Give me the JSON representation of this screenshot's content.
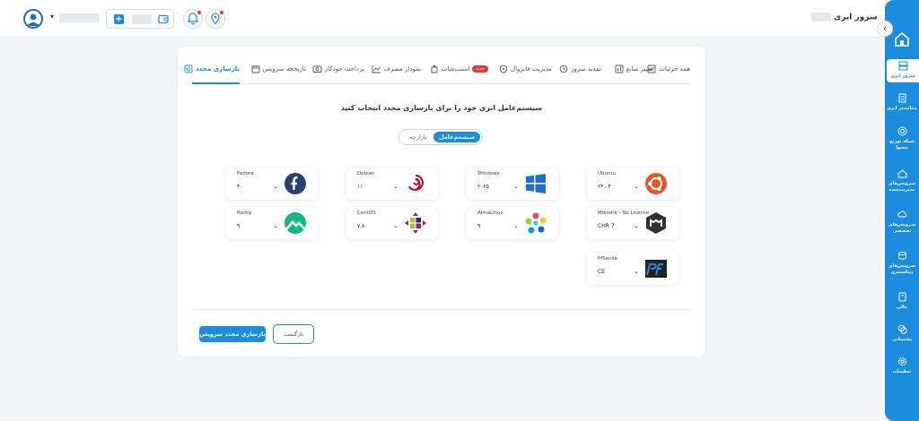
{
  "header": {
    "breadcrumb": "سرور ابری"
  },
  "sidebar": {
    "items": [
      {
        "label": "سرور ابری",
        "icon": "server-icon"
      },
      {
        "label": "دیتاسنتر ابری",
        "icon": "datacenter-icon"
      },
      {
        "label": "شبکه توزیع محتوا",
        "icon": "cdn-icon"
      },
      {
        "label": "سرویس‌های مدیریت‌شده",
        "icon": "cloud-managed-icon"
      },
      {
        "label": "سرویس‌های تخصصی",
        "icon": "cloud-special-icon"
      },
      {
        "label": "سرویس‌های دیتاسنتری",
        "icon": "datacenter-services-icon"
      },
      {
        "label": "مالی",
        "icon": "finance-icon"
      },
      {
        "label": "پشتیبانی",
        "icon": "support-icon"
      },
      {
        "label": "تنظیمات",
        "icon": "settings-icon"
      }
    ]
  },
  "tabs": [
    {
      "label": "همه جزئیات"
    },
    {
      "label": "تغییر منابع"
    },
    {
      "label": "تمدید سرور"
    },
    {
      "label": "مدیریت فایروال"
    },
    {
      "label": "اسنپ‌شات",
      "badge": "جدید"
    },
    {
      "label": "نمودار مصرف"
    },
    {
      "label": "پرداخت خودکار"
    },
    {
      "label": "تاریخچه سرویس"
    },
    {
      "label": "بازسازی مجدد"
    }
  ],
  "main": {
    "headline": "سیستم‌عامل ابری خود را برای بازسازی مجدد انتخاب کنید",
    "toggle": {
      "selected": "سیستم‌عامل",
      "other": "بازارچه"
    }
  },
  "os_options": [
    {
      "name": "Ubuntu",
      "version": "۲۴.۰۴"
    },
    {
      "name": "Windows",
      "version": "۲۰۲۵"
    },
    {
      "name": "Debian",
      "version": "۱۱"
    },
    {
      "name": "Fedora",
      "version": "۴۰"
    },
    {
      "name": "Mikrotik - No License",
      "version": "CHR 7"
    },
    {
      "name": "AlmaLinux",
      "version": "۹"
    },
    {
      "name": "CentOS",
      "version": "۷.۸"
    },
    {
      "name": "Rocky",
      "version": "۹"
    },
    {
      "name": "PfSense",
      "version": "CE"
    }
  ],
  "actions": {
    "rebuild": "بازسازی مجدد سرویس",
    "back": "بازگشت"
  },
  "colors": {
    "accent": "#1a8ddf",
    "badge": "#e53935"
  }
}
